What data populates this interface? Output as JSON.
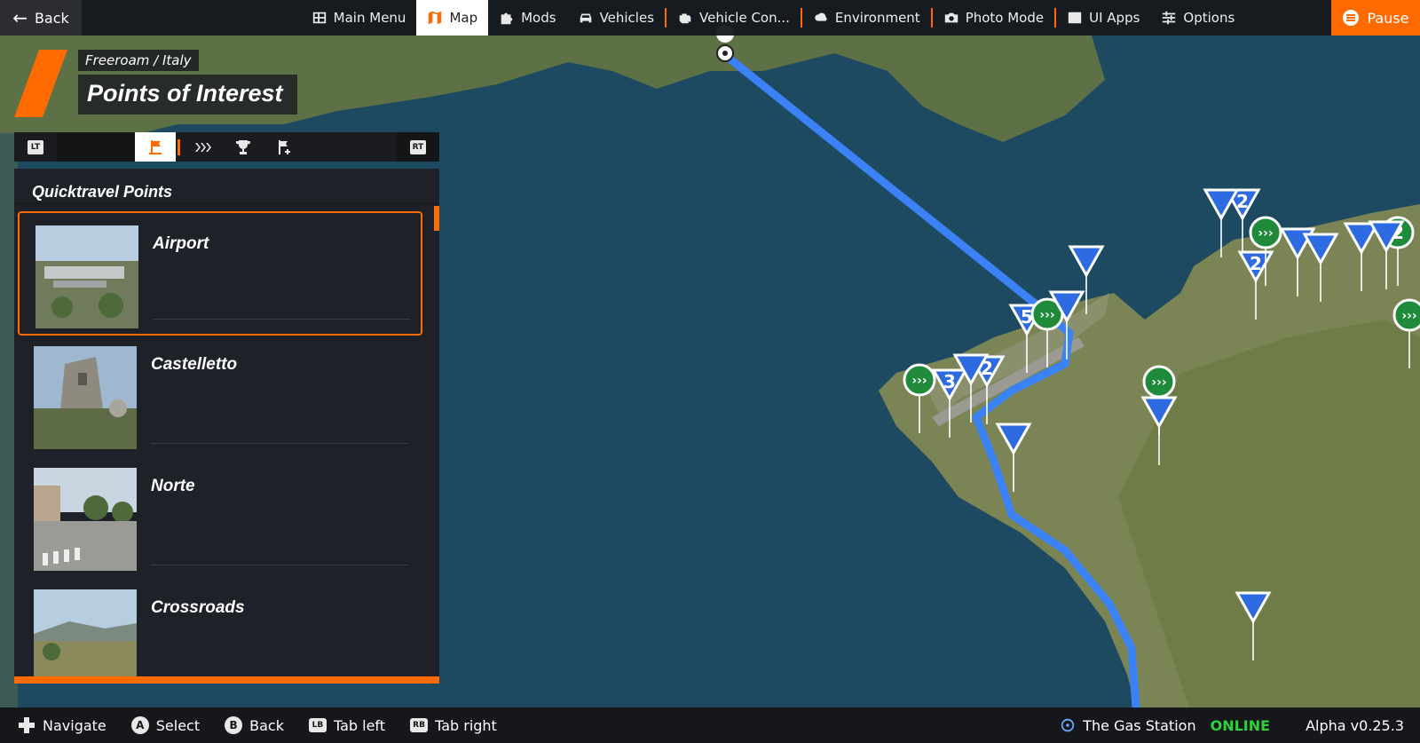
{
  "topbar": {
    "back_label": "Back",
    "pause_label": "Pause",
    "nav_items": [
      {
        "label": "Main Menu",
        "icon": "main-menu-icon"
      },
      {
        "label": "Map",
        "icon": "map-icon",
        "active": true
      },
      {
        "label": "Mods",
        "icon": "puzzle-icon"
      },
      {
        "label": "Vehicles",
        "icon": "car-icon"
      },
      {
        "label": "Vehicle Con...",
        "icon": "engine-icon"
      },
      {
        "label": "Environment",
        "icon": "weather-icon"
      },
      {
        "label": "Photo Mode",
        "icon": "camera-icon"
      },
      {
        "label": "UI Apps",
        "icon": "ui-apps-icon"
      },
      {
        "label": "Options",
        "icon": "sliders-icon"
      }
    ]
  },
  "header": {
    "breadcrumb": "Freeroam / Italy",
    "title": "Points of Interest"
  },
  "tabs": {
    "left_bumper": "LT",
    "right_bumper": "RT",
    "items": [
      {
        "icon": "quicktravel-flag-icon",
        "active": true
      },
      {
        "icon": "chevrons-icon"
      },
      {
        "icon": "trophy-icon"
      },
      {
        "icon": "add-flag-icon"
      }
    ]
  },
  "panel": {
    "title": "Quicktravel Points",
    "items": [
      {
        "label": "Airport",
        "selected": true
      },
      {
        "label": "Castelletto"
      },
      {
        "label": "Norte"
      },
      {
        "label": "Crossroads"
      }
    ]
  },
  "map_markers": [
    "5",
    "2",
    "3",
    "2",
    "2",
    "2"
  ],
  "bottombar": {
    "hints": [
      {
        "key": "",
        "label": "Navigate",
        "icon": "dpad-icon"
      },
      {
        "key": "A",
        "label": "Select"
      },
      {
        "key": "B",
        "label": "Back"
      },
      {
        "key": "LB",
        "label": "Tab left"
      },
      {
        "key": "RB",
        "label": "Tab right"
      }
    ],
    "server_name": "The Gas Station",
    "server_status": "ONLINE",
    "version": "Alpha v0.25.3"
  },
  "colors": {
    "accent": "#ff6b00",
    "route": "#3b82f6",
    "sea": "#1d4a60",
    "marker_blue": "#2f6be0",
    "marker_green": "#1f8a3a",
    "online": "#2fd13c"
  }
}
